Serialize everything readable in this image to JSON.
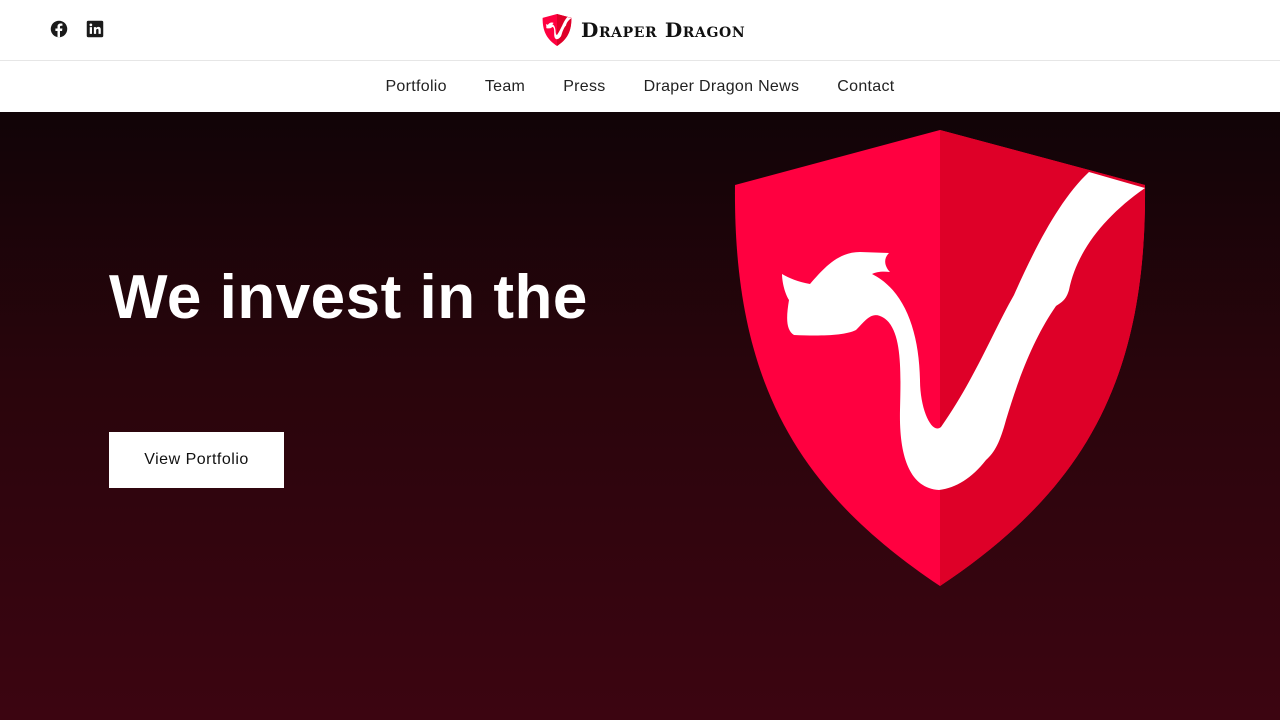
{
  "header": {
    "brand_name": "Draper Dragon",
    "social": [
      {
        "icon": "facebook-icon"
      },
      {
        "icon": "linkedin-icon"
      }
    ]
  },
  "nav": {
    "items": [
      {
        "label": "Portfolio"
      },
      {
        "label": "Team"
      },
      {
        "label": "Press"
      },
      {
        "label": "Draper Dragon News"
      },
      {
        "label": "Contact"
      }
    ]
  },
  "hero": {
    "title": "We invest in the",
    "button_label": "View Portfolio"
  },
  "colors": {
    "brand_red": "#ff0040",
    "brand_red_dark": "#de0028",
    "hero_dark": "#110407",
    "hero_maroon": "#3c0511"
  }
}
